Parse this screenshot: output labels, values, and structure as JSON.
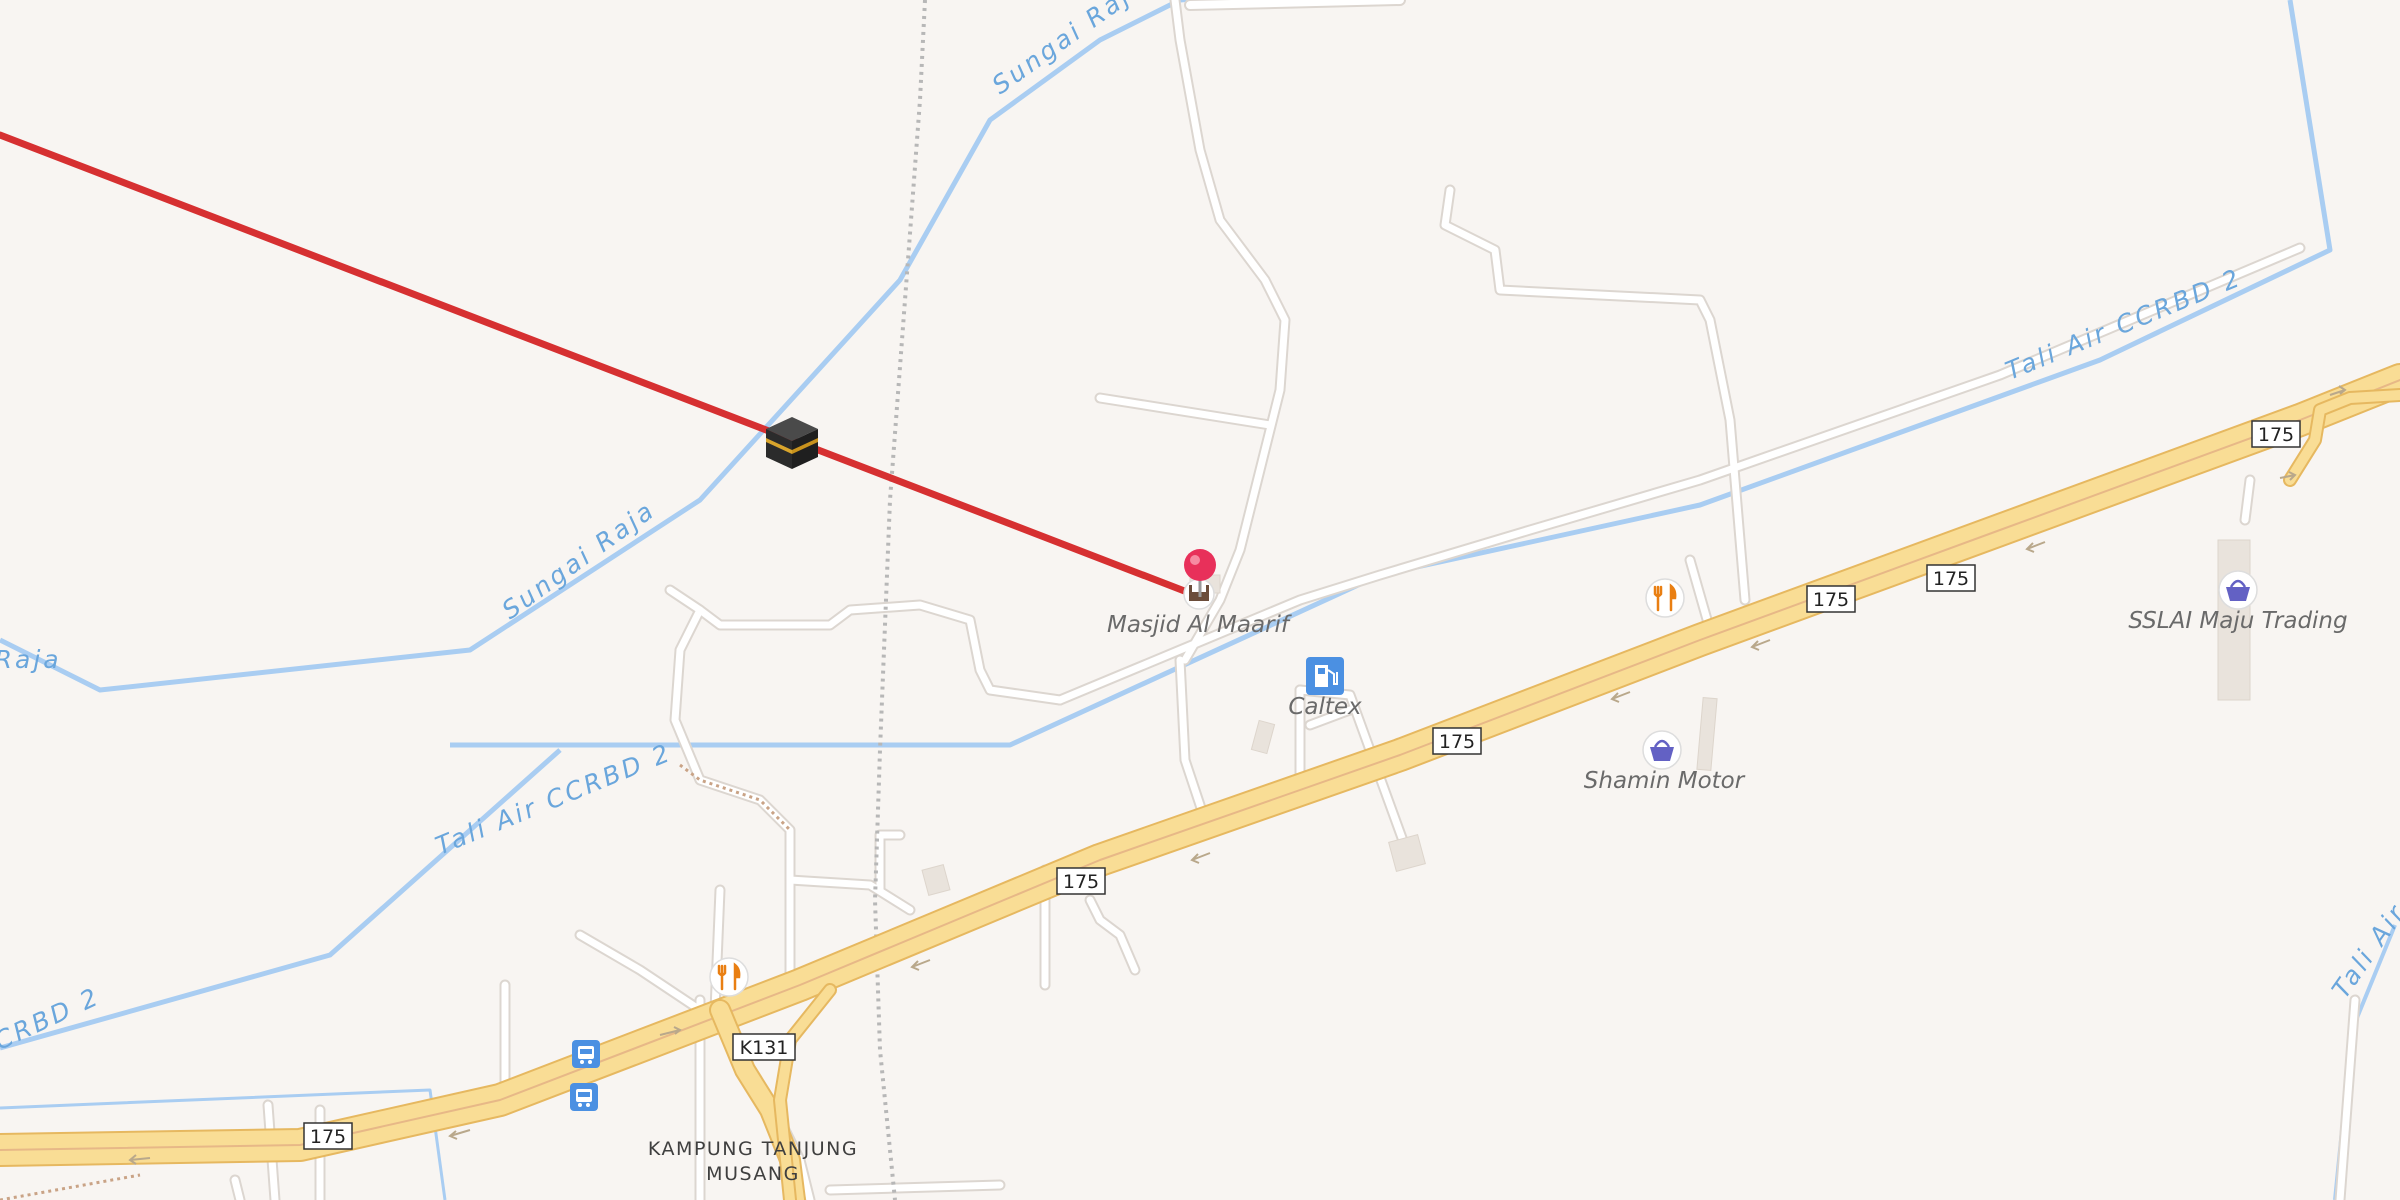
{
  "water": {
    "river_name": "Sungai Raja",
    "canal_name": "Tali Air CCRBD 2"
  },
  "roads": {
    "highway_ref": "175",
    "local_ref": "K131"
  },
  "places": {
    "village_line1": "KAMPUNG TANJUNG",
    "village_line2": "MUSANG"
  },
  "pois": {
    "mosque": "Masjid Al Maarif",
    "fuel": "Caltex",
    "shop1": "Shamin Motor",
    "shop2": "SSLAI Maju Trading"
  },
  "icons": {
    "kaaba": "kaaba-icon",
    "pin": "location-pin-icon",
    "restaurant": "restaurant-icon",
    "fuel": "fuel-station-icon",
    "shop": "shopping-basket-icon",
    "bus": "bus-stop-icon",
    "mosque": "mosque-icon"
  },
  "colors": {
    "background": "#f8f5f2",
    "road": "#ffffff",
    "road_casing": "#dcd6d0",
    "highway": "#f9dd95",
    "highway_casing": "#e6b860",
    "water": "#a9cdf2",
    "qibla_line": "#d63031",
    "pin": "#e8305a"
  }
}
